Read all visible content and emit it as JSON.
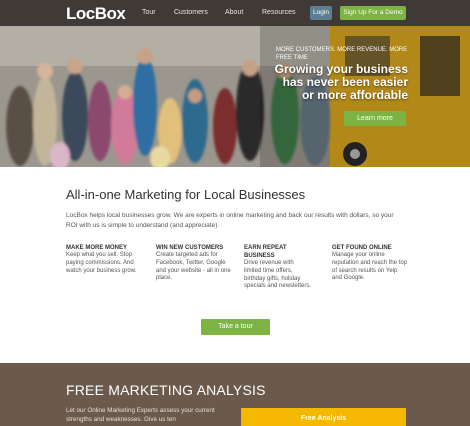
{
  "header": {
    "logo": "LocBox",
    "nav": [
      "Tour",
      "Customers",
      "About",
      "Resources"
    ],
    "login_label": "Login",
    "demo_label": "Sign Up For a Demo"
  },
  "hero": {
    "tagline": "MORE CUSTOMERS. MORE REVENUE. MORE FREE TIME",
    "headline": "Growing your business has never been easier or more affordable",
    "cta_label": "Learn more"
  },
  "main": {
    "title": "All-in-one Marketing for Local Businesses",
    "intro": "LocBox helps local businesses grow. We are experts in online marketing and back our results with dollars, so your ROI with us is simple to understand (and appreciate).",
    "features": [
      {
        "title": "MAKE MORE MONEY",
        "text": "Keep what you sell. Stop paying commissions. And watch your business grow."
      },
      {
        "title": "WIN NEW CUSTOMERS",
        "text": "Create targeted ads for Facebook, Twitter, Google and your website - all in one place."
      },
      {
        "title": "EARN REPEAT BUSINESS",
        "text": "Drive revenue with limited time offers, birthday gifts, holiday specials and newsletters."
      },
      {
        "title": "GET FOUND ONLINE",
        "text": "Manage your online reputation and reach the top of search results on Yelp and Google."
      }
    ],
    "tour_label": "Take a tour"
  },
  "analysis": {
    "title": "FREE MARKETING ANALYSIS",
    "text": "Let our Online Marketing Experts assess your current strengths and weaknesses. Give us ten",
    "button_label": "Free Analysis"
  },
  "colors": {
    "header_bg": "#3f3a36",
    "accent_green": "#7cb342",
    "login_blue": "#5a7f93",
    "analysis_bg": "#6b5a4c",
    "analysis_button": "#f5b800"
  }
}
